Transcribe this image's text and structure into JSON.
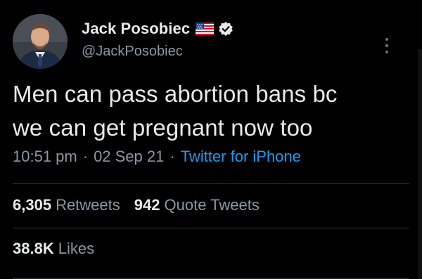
{
  "author": {
    "display_name": "Jack Posobiec",
    "handle": "@JackPosobiec",
    "flag_icon": "us-flag-icon",
    "verified_icon": "verified-badge-icon"
  },
  "tweet": {
    "text_line1": "Men can pass abortion bans bc",
    "text_line2": "we can get pregnant now too"
  },
  "meta": {
    "time": "10:51 pm",
    "separator": "·",
    "date": "02 Sep 21",
    "source": "Twitter for iPhone"
  },
  "stats": {
    "retweets_count": "6,305",
    "retweets_label": "Retweets",
    "quote_count": "942",
    "quote_label": "Quote Tweets",
    "likes_count": "38.8K",
    "likes_label": "Likes"
  },
  "colors": {
    "background": "#000000",
    "text_primary": "#e7e9ea",
    "text_secondary": "#8b98a5",
    "link_blue": "#1d9bf0",
    "divider": "#2f3336"
  }
}
